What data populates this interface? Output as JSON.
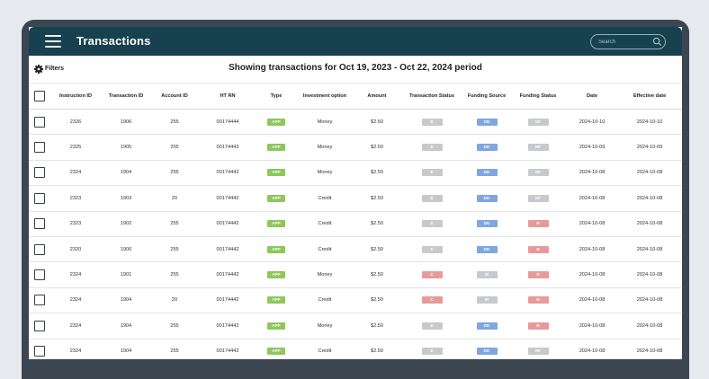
{
  "app": {
    "title": "Transactions"
  },
  "search": {
    "placeholder": "Search"
  },
  "filters": {
    "label": "Filters"
  },
  "period_title": "Showing transactions for Oct 19, 2023 - Oct 22, 2024 period",
  "colors": {
    "topbar": "#17414f",
    "type_app": "#8cc85a",
    "status_e": "#c7c9cc",
    "status_c": "#e89a9a",
    "source_dd": "#7fa6e0",
    "source_m": "#c7c9cc",
    "funding_nf": "#c7c9cc",
    "funding_r": "#e89a9a"
  },
  "table": {
    "columns": [
      "Instruction ID",
      "Transaction ID",
      "Account ID",
      "HT RN",
      "Type",
      "Investment option",
      "Amount",
      "Transaction Status",
      "Funding Source",
      "Funding Status",
      "Date",
      "Effective date"
    ],
    "rows": [
      {
        "instruction_id": "2326",
        "transaction_id": "1906",
        "account_id": "255",
        "ht_rn": "00174444",
        "type": "APP",
        "investment_option": "Money",
        "amount": "$2.50",
        "transaction_status": "E",
        "funding_source": "DD",
        "funding_status": "NF",
        "date": "2024-10-10",
        "effective_date": "2024-10-10"
      },
      {
        "instruction_id": "2325",
        "transaction_id": "1905",
        "account_id": "255",
        "ht_rn": "00174443",
        "type": "APP",
        "investment_option": "Money",
        "amount": "$2.50",
        "transaction_status": "E",
        "funding_source": "DD",
        "funding_status": "NF",
        "date": "2024-10-09",
        "effective_date": "2024-10-09"
      },
      {
        "instruction_id": "2324",
        "transaction_id": "1904",
        "account_id": "255",
        "ht_rn": "00174442",
        "type": "APP",
        "investment_option": "Money",
        "amount": "$2.50",
        "transaction_status": "E",
        "funding_source": "DD",
        "funding_status": "NF",
        "date": "2024-10-08",
        "effective_date": "2024-10-08"
      },
      {
        "instruction_id": "2323",
        "transaction_id": "1903",
        "account_id": "20",
        "ht_rn": "00174442",
        "type": "APP",
        "investment_option": "Credit",
        "amount": "$2.50",
        "transaction_status": "E",
        "funding_source": "DD",
        "funding_status": "NF",
        "date": "2024-10-08",
        "effective_date": "2024-10-08"
      },
      {
        "instruction_id": "2323",
        "transaction_id": "1902",
        "account_id": "255",
        "ht_rn": "00174442",
        "type": "APP",
        "investment_option": "Credit",
        "amount": "$2.50",
        "transaction_status": "E",
        "funding_source": "DD",
        "funding_status": "R",
        "date": "2024-10-08",
        "effective_date": "2024-10-08"
      },
      {
        "instruction_id": "2320",
        "transaction_id": "1900",
        "account_id": "255",
        "ht_rn": "00174442",
        "type": "APP",
        "investment_option": "Credit",
        "amount": "$2.50",
        "transaction_status": "E",
        "funding_source": "DD",
        "funding_status": "R",
        "date": "2024-10-08",
        "effective_date": "2024-10-08"
      },
      {
        "instruction_id": "2324",
        "transaction_id": "1901",
        "account_id": "255",
        "ht_rn": "00174442",
        "type": "APP",
        "investment_option": "Money",
        "amount": "$2.50",
        "transaction_status": "C",
        "funding_source": "M",
        "funding_status": "R",
        "date": "2024-10-08",
        "effective_date": "2024-10-08"
      },
      {
        "instruction_id": "2324",
        "transaction_id": "1904",
        "account_id": "20",
        "ht_rn": "00174442",
        "type": "APP",
        "investment_option": "Credit",
        "amount": "$2.50",
        "transaction_status": "C",
        "funding_source": "M",
        "funding_status": "R",
        "date": "2024-10-08",
        "effective_date": "2024-10-08"
      },
      {
        "instruction_id": "2324",
        "transaction_id": "1904",
        "account_id": "255",
        "ht_rn": "00174442",
        "type": "APP",
        "investment_option": "Money",
        "amount": "$2.50",
        "transaction_status": "E",
        "funding_source": "DD",
        "funding_status": "R",
        "date": "2024-10-08",
        "effective_date": "2024-10-08"
      },
      {
        "instruction_id": "2324",
        "transaction_id": "1904",
        "account_id": "255",
        "ht_rn": "00174442",
        "type": "APP",
        "investment_option": "Credit",
        "amount": "$2.50",
        "transaction_status": "E",
        "funding_source": "DD",
        "funding_status": "NF",
        "date": "2024-10-08",
        "effective_date": "2024-10-08"
      }
    ]
  }
}
